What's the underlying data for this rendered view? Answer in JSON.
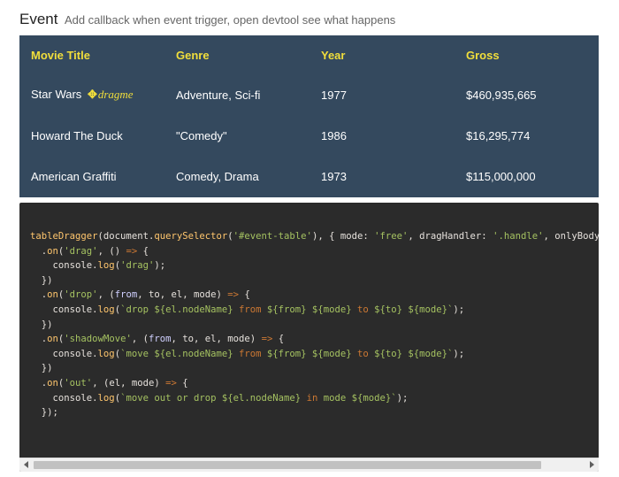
{
  "heading": {
    "title": "Event",
    "subtitle": "Add callback when event trigger, open devtool see what happens"
  },
  "table": {
    "columns": [
      "Movie Title",
      "Genre",
      "Year",
      "Gross"
    ],
    "rows": [
      {
        "title": "Star Wars",
        "handle_label": "dragme",
        "genre": "Adventure, Sci-fi",
        "year": "1977",
        "gross": "$460,935,665"
      },
      {
        "title": "Howard The Duck",
        "genre": "\"Comedy\"",
        "year": "1986",
        "gross": "$16,295,774"
      },
      {
        "title": "American Graffiti",
        "genre": "Comedy, Drama",
        "year": "1973",
        "gross": "$115,000,000"
      }
    ]
  },
  "handle_icon": "move-arrows-icon",
  "colors": {
    "table_bg": "#34495e",
    "header_text": "#f1de3b",
    "code_bg": "#2b2b2b"
  },
  "code": {
    "line1_fn": "tableDragger",
    "line1_doc": "(document.",
    "line1_qs": "querySelector",
    "line1_sel": "'#event-table'",
    "line1_mode_key": "), { mode: ",
    "line1_mode_val": "'free'",
    "line1_handler_key": ", dragHandler: ",
    "line1_handler_val": "'.handle'",
    "line1_rest": ", onlyBody:",
    "ev_drag": "'drag'",
    "ev_drop": "'drop'",
    "ev_shadow": "'shadowMove'",
    "ev_out": "'out'",
    "log_drag": "'drag'",
    "tpl_drop_a": "`drop ${el.nodeName} ",
    "tpl_from": "from",
    "tpl_from_var": " ${from} ${mode} ",
    "tpl_to": "to",
    "tpl_to_var": " ${to} ${mode}`",
    "tpl_move_a": "`move ${el.nodeName} ",
    "tpl_out_a": "`move out or drop ${el.nodeName} ",
    "tpl_in": "in",
    "tpl_mode": " mode",
    "tpl_out_b": " ${mode}`"
  }
}
